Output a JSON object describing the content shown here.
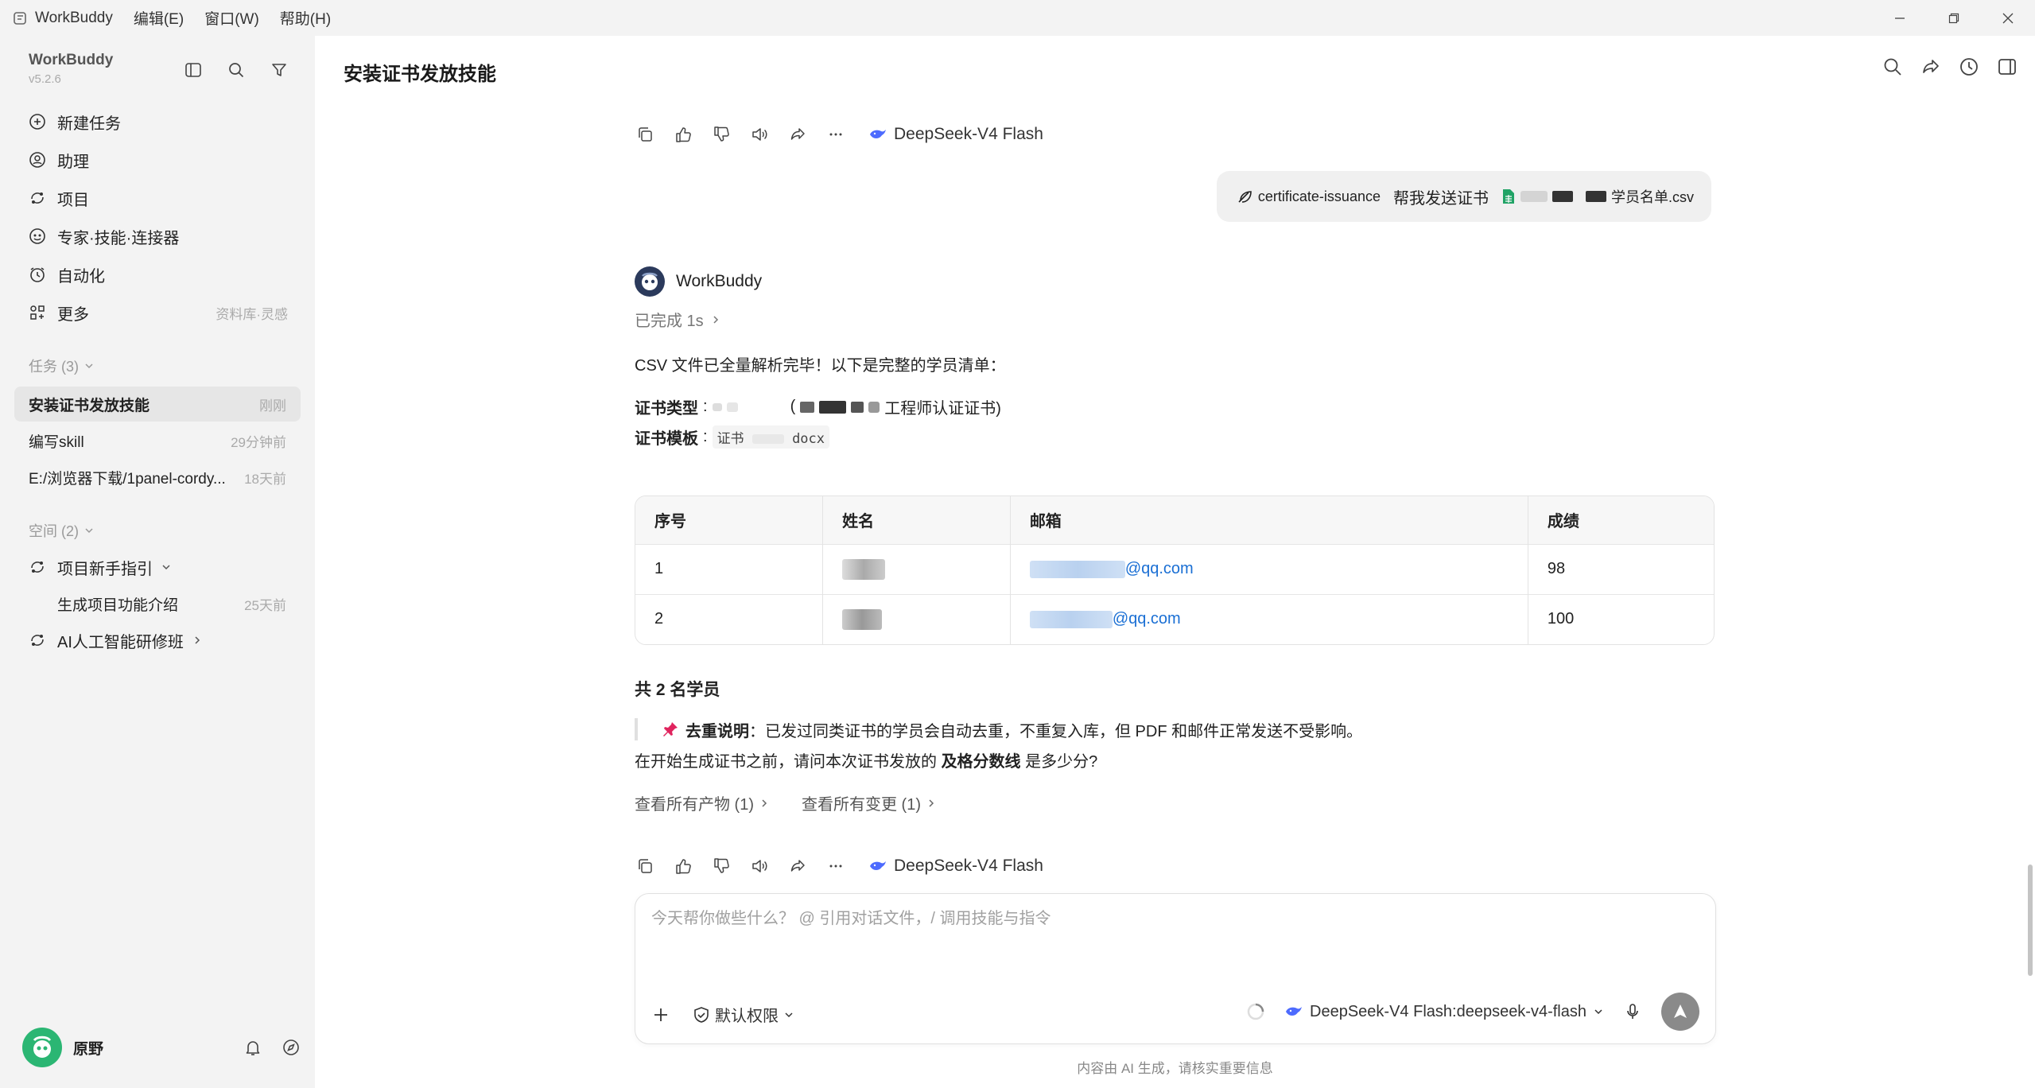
{
  "titlebar": {
    "app_name": "WorkBuddy",
    "menus": [
      "编辑(E)",
      "窗口(W)",
      "帮助(H)"
    ]
  },
  "sidebar": {
    "brand_name": "WorkBuddy",
    "version": "v5.2.6",
    "nav": [
      {
        "label": "新建任务",
        "icon": "plus-circle-icon"
      },
      {
        "label": "助理",
        "icon": "assistant-icon"
      },
      {
        "label": "项目",
        "icon": "project-icon"
      },
      {
        "label": "专家·技能·连接器",
        "icon": "expert-icon"
      },
      {
        "label": "自动化",
        "icon": "alarm-clock-icon"
      },
      {
        "label": "更多",
        "icon": "grid-icon",
        "hint": "资料库·灵感"
      }
    ],
    "tasks_label": "任务 (3)",
    "tasks": [
      {
        "name": "安装证书发放技能",
        "time": "刚刚"
      },
      {
        "name": "编写skill",
        "time": "29分钟前"
      },
      {
        "name": "E:/浏览器下载/1panel-cordy...",
        "time": "18天前"
      }
    ],
    "spaces_label": "空间 (2)",
    "spaces": [
      {
        "name": "项目新手指引",
        "sub": [
          {
            "name": "生成项目功能介绍",
            "time": "25天前"
          }
        ]
      },
      {
        "name": "AI人工智能研修班"
      }
    ],
    "user": {
      "name": "原野"
    }
  },
  "main": {
    "title": "安装证书发放技能",
    "model_name": "DeepSeek-V4 Flash",
    "user_message": {
      "skill": "certificate-issuance",
      "text": "帮我发送证书",
      "file_suffix": "学员名单.csv"
    },
    "bot": {
      "name": "WorkBuddy",
      "status": "已完成 1s",
      "intro": "CSV 文件已全量解析完毕！以下是完整的学员清单：",
      "cert_type_label": "证书类型",
      "cert_type_value": "工程师认证证书)",
      "cert_template_label": "证书模板",
      "cert_template_prefix": "证书",
      "cert_template_ext": "docx",
      "table": {
        "headers": [
          "序号",
          "姓名",
          "邮箱",
          "成绩"
        ],
        "rows": [
          {
            "no": "1",
            "email_suffix": "@qq.com",
            "score": "98"
          },
          {
            "no": "2",
            "email_suffix": "@qq.com",
            "score": "100"
          }
        ]
      },
      "total": "共 2 名学员",
      "dedup_label": "去重说明",
      "dedup_text": "已发过同类证书的学员会自动去重，不重复入库，但 PDF 和邮件正常发送不受影响。",
      "question_pre": "在开始生成证书之前，请问本次证书发放的 ",
      "question_bold": "及格分数线",
      "question_post": " 是多少分?",
      "link_artifacts": "查看所有产物 (1)",
      "link_changes": "查看所有变更 (1)"
    }
  },
  "composer": {
    "placeholder": "今天帮你做些什么？ @ 引用对话文件，/ 调用技能与指令",
    "permission": "默认权限",
    "model": "DeepSeek-V4 Flash:deepseek-v4-flash"
  },
  "footnote": "内容由 AI 生成，请核实重要信息",
  "colors": {
    "accent_link": "#1a6fd4",
    "avatar_green": "#2bb673",
    "sidebar_bg": "#f3f3f3"
  }
}
